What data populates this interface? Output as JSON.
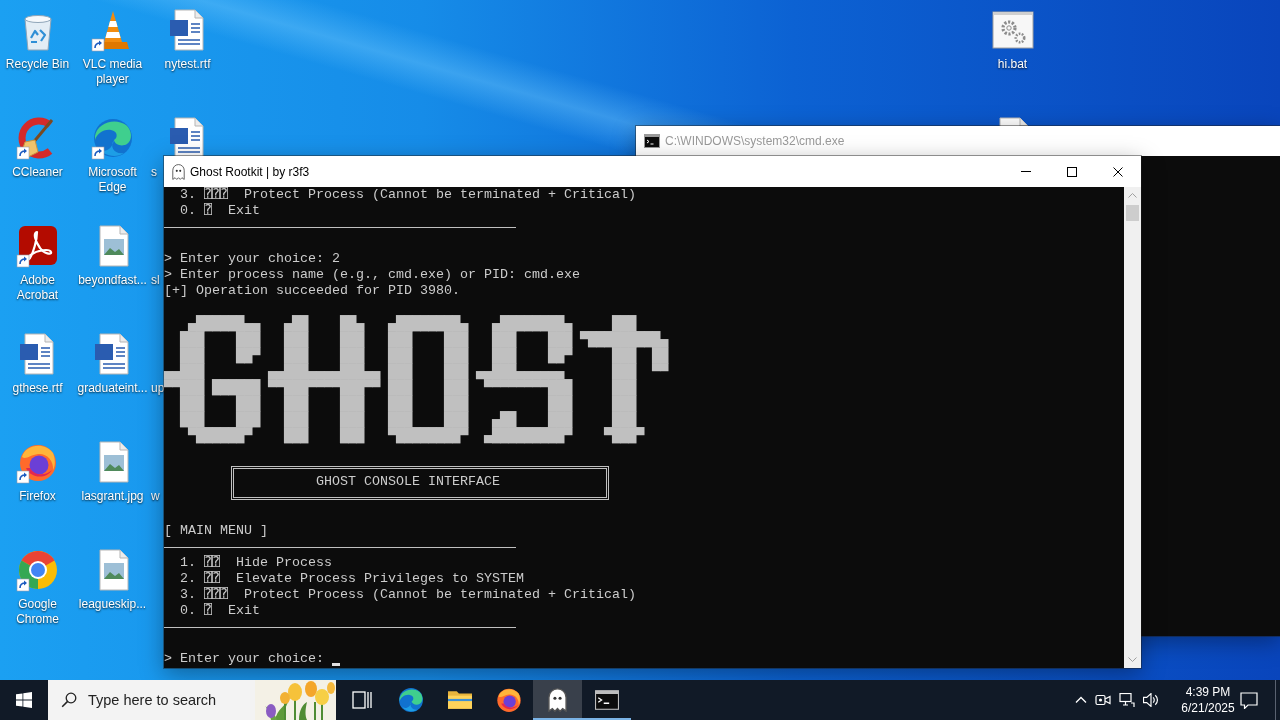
{
  "desktop": {
    "left_columns": [
      [
        {
          "label": "Recycle Bin",
          "kind": "recycle-bin",
          "shortcut": false
        },
        {
          "label": "CCleaner",
          "kind": "ccleaner",
          "shortcut": true
        },
        {
          "label": "Adobe Acrobat",
          "kind": "acrobat",
          "shortcut": true
        },
        {
          "label": "gthese.rtf",
          "kind": "word-doc",
          "shortcut": false
        },
        {
          "label": "Firefox",
          "kind": "firefox",
          "shortcut": true
        },
        {
          "label": "Google Chrome",
          "kind": "chrome",
          "shortcut": true
        }
      ],
      [
        {
          "label": "VLC media player",
          "kind": "vlc",
          "shortcut": true
        },
        {
          "label": "Microsoft Edge",
          "kind": "edge",
          "shortcut": true
        },
        {
          "label": "beyondfast...",
          "kind": "image-file",
          "shortcut": false
        },
        {
          "label": "graduateint...",
          "kind": "word-doc",
          "shortcut": false
        },
        {
          "label": "lasgrant.jpg",
          "kind": "image-file",
          "shortcut": false
        },
        {
          "label": "leagueskip...",
          "kind": "image-file",
          "shortcut": false
        }
      ],
      [
        {
          "label": "nytest.rtf",
          "kind": "word-doc",
          "shortcut": false
        },
        {
          "label": "s",
          "kind": "word-doc",
          "shortcut": false
        },
        {
          "label": "sl"
        },
        {
          "label": "up"
        },
        {
          "label": "w"
        }
      ]
    ],
    "right_column": [
      {
        "label": "hi.bat",
        "kind": "batch-file",
        "shortcut": false
      },
      {
        "kind": "document"
      }
    ]
  },
  "background_window": {
    "title": "C:\\WINDOWS\\system32\\cmd.exe",
    "active": false
  },
  "console_window": {
    "title": "Ghost Rootkit | by r3f3",
    "active": true,
    "lines": [
      {
        "kind": "item",
        "text": "3. ⍰⍰⍰  Protect Process (Cannot be terminated + Critical)"
      },
      {
        "kind": "item",
        "text": "0. ⍰  Exit"
      },
      {
        "kind": "rule"
      },
      {
        "kind": "blank"
      },
      {
        "kind": "text",
        "text": "> Enter your choice: 2"
      },
      {
        "kind": "text",
        "text": "> Enter process name (e.g., cmd.exe) or PID: cmd.exe"
      },
      {
        "kind": "text",
        "text": "[+] Operation succeeded for PID 3980."
      },
      {
        "kind": "blank"
      },
      {
        "kind": "banner",
        "lines": [
          "   ▄██████▄▄   ▄██    ██▄   ▄████████▄   ▄████████▄     ███",
          "  ███    ███   ███    ███   ███    ███   ███    ███ ▀█████████▄",
          "  ███    ██▀   ███    ███   ███    ███   ███    ██▀     ███  ██",
          "▄▄███        ▄▄███▄▄▄▄███▄▄ ███    ███ ▄▄███▄▄▄▄▄▄      ███  ▀▀",
          "▀▀███ ██████ ▀▀███▀▀▀▀███▀▀ ███    ███  ▀▀▀▀▀▀▀▀███     ███",
          "  ███    ███   ███    ███   ███    ███          ███     ███",
          "  ███    ███   ███    ███   ███    ███   ▄██    ███     ███",
          "   ▀██████▀    ███    ███   ▀████████▀  ▄█████████▀    ▀███▀"
        ]
      },
      {
        "kind": "blank"
      },
      {
        "kind": "framed",
        "text": "GHOST CONSOLE INTERFACE"
      },
      {
        "kind": "blank"
      },
      {
        "kind": "text",
        "text": "[ MAIN MENU ]"
      },
      {
        "kind": "rule"
      },
      {
        "kind": "item",
        "text": "1. ⍰⍰  Hide Process"
      },
      {
        "kind": "item",
        "text": "2. ⍰⍰  Elevate Process Privileges to SYSTEM"
      },
      {
        "kind": "item",
        "text": "3. ⍰⍰⍰  Protect Process (Cannot be terminated + Critical)"
      },
      {
        "kind": "item",
        "text": "0. ⍰  Exit"
      },
      {
        "kind": "rule"
      },
      {
        "kind": "blank"
      },
      {
        "kind": "prompt",
        "text": "> Enter your choice: "
      }
    ]
  },
  "taskbar": {
    "search": {
      "placeholder": "Type here to search"
    },
    "apps": [
      {
        "kind": "task-view",
        "running": false,
        "selected": false
      },
      {
        "kind": "edge",
        "running": false,
        "selected": false
      },
      {
        "kind": "file-explorer",
        "running": false,
        "selected": false
      },
      {
        "kind": "firefox",
        "running": false,
        "selected": false
      },
      {
        "kind": "ghost",
        "running": true,
        "selected": true
      },
      {
        "kind": "console",
        "running": true,
        "selected": false
      }
    ],
    "clock": {
      "time": "4:39 PM",
      "date": "6/21/2025"
    }
  }
}
